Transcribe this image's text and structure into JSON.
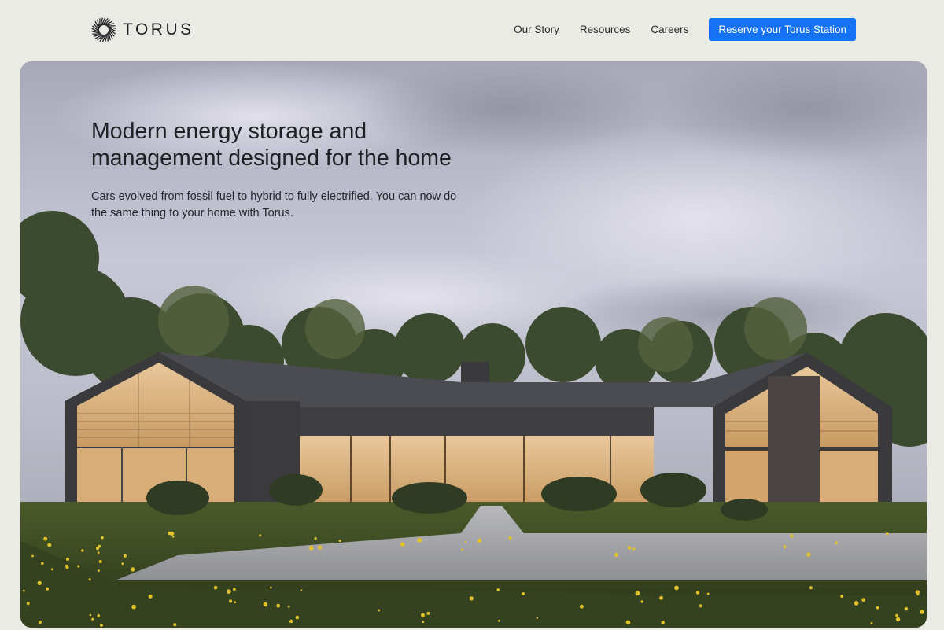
{
  "brand": {
    "name": "TORUS",
    "logo_icon": "torus-ring-icon"
  },
  "nav": {
    "items": [
      {
        "label": "Our Story"
      },
      {
        "label": "Resources"
      },
      {
        "label": "Careers"
      }
    ],
    "cta_label": "Reserve your Torus Station"
  },
  "hero": {
    "title": "Modern energy storage and management designed for the home",
    "subtitle": "Cars evolved from fossil fuel to hybrid to fully electrified. You can now do the same thing to your home with Torus.",
    "image": "modern-house-photo"
  },
  "colors": {
    "background": "#ebebe6",
    "accent": "#1572f3",
    "text": "#1e2124"
  }
}
